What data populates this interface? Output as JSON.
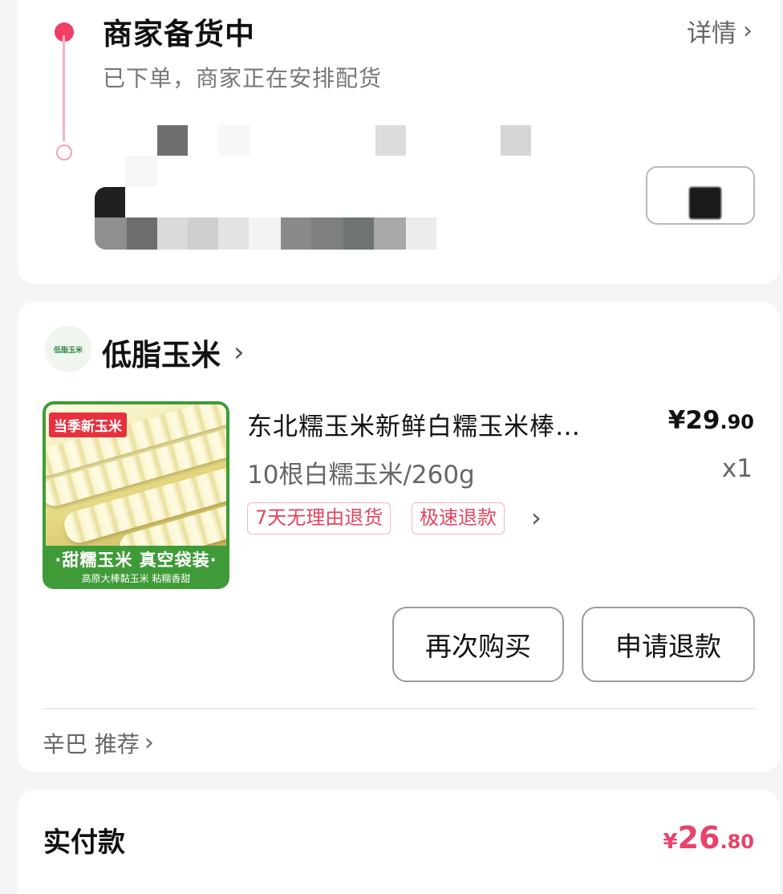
{
  "status": {
    "title": "商家备货中",
    "description": "已下单，商家正在安排配货",
    "detail_link": "详情"
  },
  "shop": {
    "logo_text": "低脂玉米",
    "name": "低脂玉米"
  },
  "product": {
    "image_tag": "当季新玉米",
    "image_caption": "·甜糯玉米 真空袋装·",
    "image_subcaption": "高原大棒黏玉米 粘糯香甜",
    "title": "东北糯玉米新鲜白糯玉米棒…",
    "price_currency": "¥",
    "price_int": "29",
    "price_dec": ".90",
    "spec": "10根白糯玉米/260g",
    "quantity": "x1",
    "tags": [
      "7天无理由退货",
      "极速退款"
    ]
  },
  "actions": {
    "rebuy": "再次购买",
    "refund": "申请退款"
  },
  "recommend": "辛巴 推荐",
  "payment": {
    "label": "实付款",
    "currency": "¥",
    "amount_int": "26",
    "amount_dec": ".80"
  },
  "colors": {
    "accent": "#f03e64",
    "tag_text": "#e3455f",
    "pay_amount": "#e8426a"
  }
}
